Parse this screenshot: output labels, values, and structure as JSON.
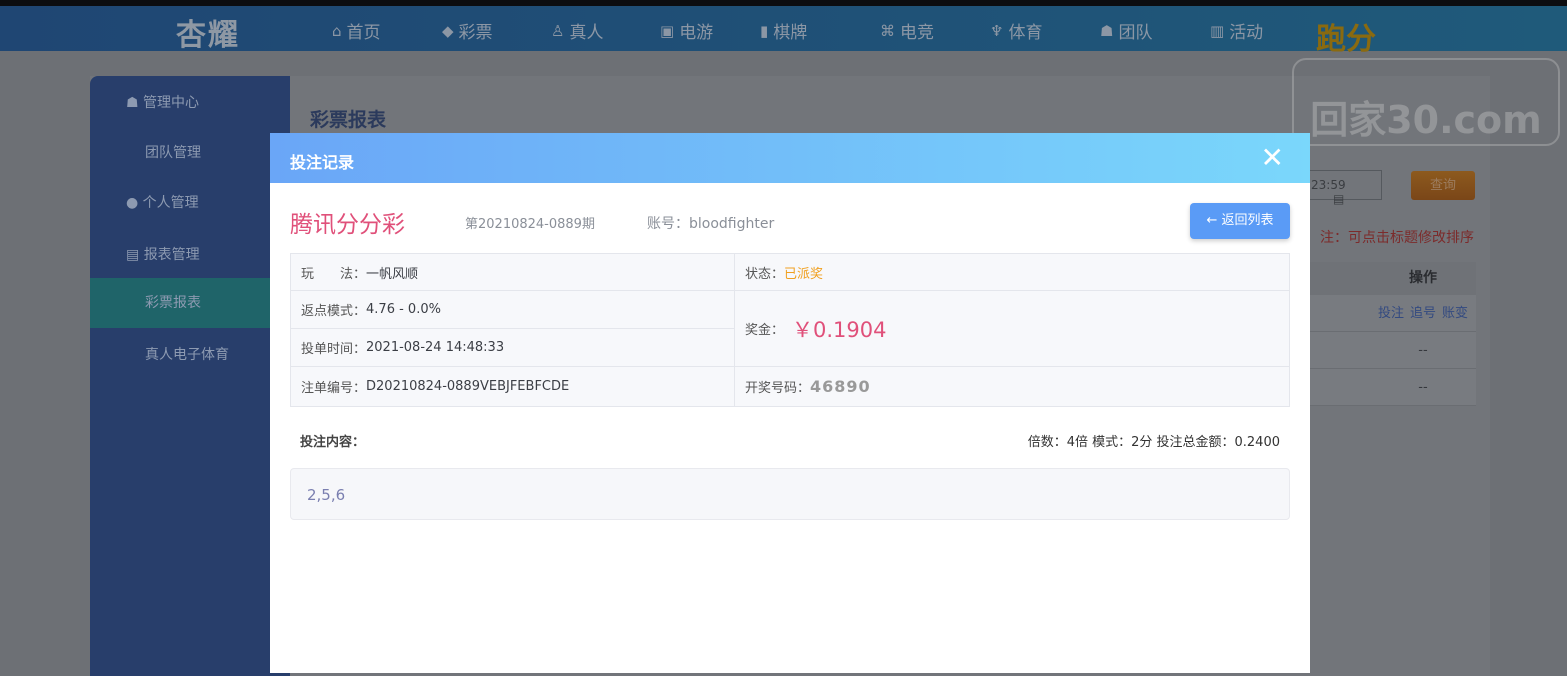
{
  "nav": {
    "logo": "杏耀",
    "items": [
      {
        "label": "首页",
        "icon": "home-icon",
        "glyph": "⌂"
      },
      {
        "label": "彩票",
        "icon": "lottery-icon",
        "glyph": "◆"
      },
      {
        "label": "真人",
        "icon": "live-dealer-icon",
        "glyph": "♙"
      },
      {
        "label": "电游",
        "icon": "slot-machine-icon",
        "glyph": "▣"
      },
      {
        "label": "棋牌",
        "icon": "card-icon",
        "glyph": "▮"
      },
      {
        "label": "电竞",
        "icon": "gamepad-icon",
        "glyph": "⌘"
      },
      {
        "label": "体育",
        "icon": "trophy-icon",
        "glyph": "♆"
      },
      {
        "label": "团队",
        "icon": "team-icon",
        "glyph": "☗"
      },
      {
        "label": "活动",
        "icon": "gift-icon",
        "glyph": "▥"
      }
    ],
    "highlight": "跑分"
  },
  "watermark": "回家30.com",
  "sidebar": {
    "items": [
      {
        "label": "管理中心",
        "type": "group"
      },
      {
        "label": "团队管理",
        "type": "sub"
      },
      {
        "label": "个人管理",
        "type": "group"
      },
      {
        "label": "报表管理",
        "type": "group"
      },
      {
        "label": "彩票报表",
        "type": "sub",
        "active": true
      },
      {
        "label": "真人电子体育",
        "type": "sub"
      }
    ]
  },
  "page": {
    "title": "彩票报表",
    "date_fragment": "23:59",
    "query_button": "查询",
    "note": "注：可点击标题修改排序",
    "table": {
      "header": "操作",
      "rows": [
        [
          "投注",
          "追号",
          "账变"
        ],
        [
          "--"
        ],
        [
          "--"
        ]
      ]
    }
  },
  "modal": {
    "title": "投注记录",
    "lottery_name": "腾讯分分彩",
    "issue": "第20210824-0889期",
    "account": "账号：bloodfighter",
    "back_button": "返回列表",
    "play_label": "玩　　法：",
    "play": "一帆风顺",
    "status_label": "状态：",
    "status": "已派奖",
    "rebate_label": "返点模式：",
    "rebate": "4.76 - 0.0%",
    "prize_label": "奖金：",
    "prize": "￥0.1904",
    "time_label": "投单时间：",
    "time": "2021-08-24 14:48:33",
    "order_label": "注单编号：",
    "order": "D20210824-0889VEBJFEBFCDE",
    "win_label": "开奖号码：",
    "win_number": "46890",
    "content_label": "投注内容：",
    "summary": "倍数：4倍  模式：2分  投注总金额：0.2400",
    "content": "2,5,6"
  },
  "colors": {
    "accent": "#e0507a",
    "status": "#f0a020",
    "header_start": "#6aa6f7",
    "header_end": "#7ad7fb",
    "button": "#5a9bf6"
  }
}
